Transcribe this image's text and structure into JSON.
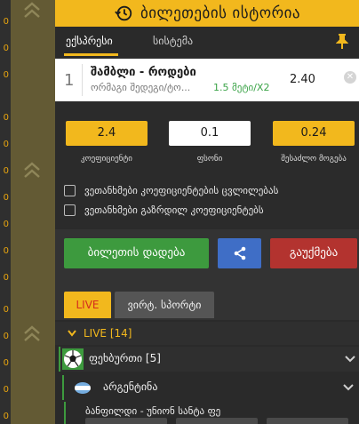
{
  "header": {
    "title": "ბილეთების ისტორია",
    "icon": "history-icon"
  },
  "tabs": {
    "express": "ექსპრესი",
    "system": "სისტემა"
  },
  "bet": {
    "number": "1",
    "match": "შამბლი - როდები",
    "market": "ორმაგი შედეგი/ტო...",
    "pick": "1.5 მეტი/X2",
    "odd": "2.40"
  },
  "fields": {
    "coef_value": "2.4",
    "stake_value": "0.1",
    "win_value": "0.24",
    "coef_label": "კოეფიციენტი",
    "stake_label": "ფსონი",
    "win_label": "შესაძლო მოგება"
  },
  "options": {
    "accept_changes": "ვეთანხმები კოეფიციენტების ცვლილებას",
    "accept_increase": "ვეთანხმები გაზრდილ კოეფიციენტებს"
  },
  "actions": {
    "place": "ბილეთის დადება",
    "cancel": "გაუქმება"
  },
  "live": {
    "tab_live": "LIVE",
    "tab_virtual": "ვირტ. სპორტი",
    "header": "LIVE  [14]",
    "sport": "ფეხბურთი [5]",
    "country": "არგენტინა",
    "event": "ბანფილდი - უნიონ სანტა ფე"
  },
  "left_ticks": [
    "0",
    "0",
    "0",
    "0",
    "0",
    "0",
    "0",
    "0",
    "0",
    "0",
    "0",
    "0",
    "0",
    "0",
    "0"
  ],
  "colors": {
    "accent": "#f2b81d",
    "green": "#3d9a3e",
    "blue": "#3f6ec6",
    "red": "#b3332f"
  }
}
